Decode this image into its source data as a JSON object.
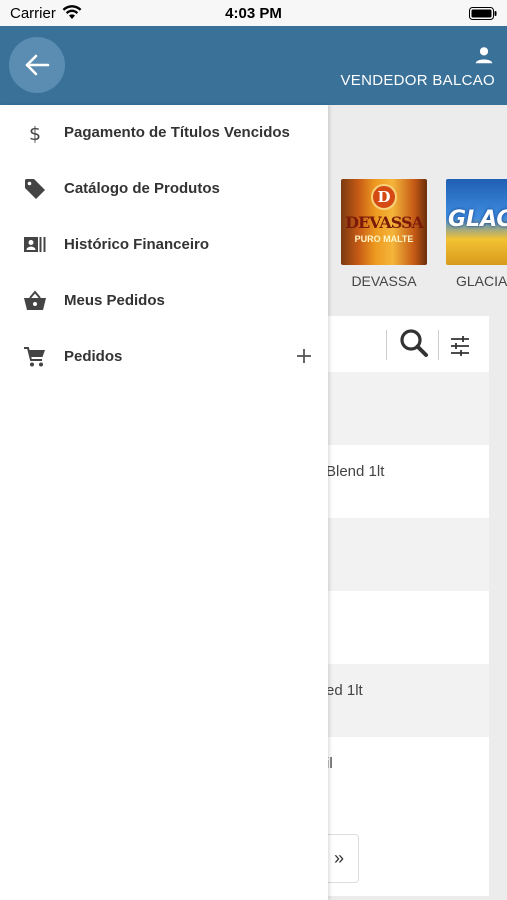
{
  "status_bar": {
    "carrier": "Carrier",
    "time": "4:03 PM"
  },
  "header": {
    "user_name": "VENDEDOR BALCAO"
  },
  "brands": [
    {
      "label": "DEVASSA",
      "logo_letter": "D",
      "logo_word": "DEVASSA",
      "logo_sub": "PURO MALTE"
    },
    {
      "label": "GLACIA",
      "logo_word": "GLACI"
    }
  ],
  "product_rows": [
    {
      "text": ""
    },
    {
      "text": "Blend 1lt"
    },
    {
      "text": ""
    },
    {
      "text": ""
    },
    {
      "text": "ed 1lt"
    },
    {
      "text": "il"
    }
  ],
  "pager": {
    "next_label": "»"
  },
  "drawer": {
    "items": [
      {
        "label": "Pagamento de Títulos Vencidos",
        "icon": "dollar-icon"
      },
      {
        "label": "Catálogo de Produtos",
        "icon": "tag-icon"
      },
      {
        "label": "Histórico Financeiro",
        "icon": "contact-card-icon"
      },
      {
        "label": "Meus Pedidos",
        "icon": "basket-icon"
      },
      {
        "label": "Pedidos",
        "icon": "cart-icon",
        "expandable": true
      }
    ]
  },
  "colors": {
    "header": "#3a7199",
    "back_button": "#5b8db2",
    "icon": "#444444"
  }
}
